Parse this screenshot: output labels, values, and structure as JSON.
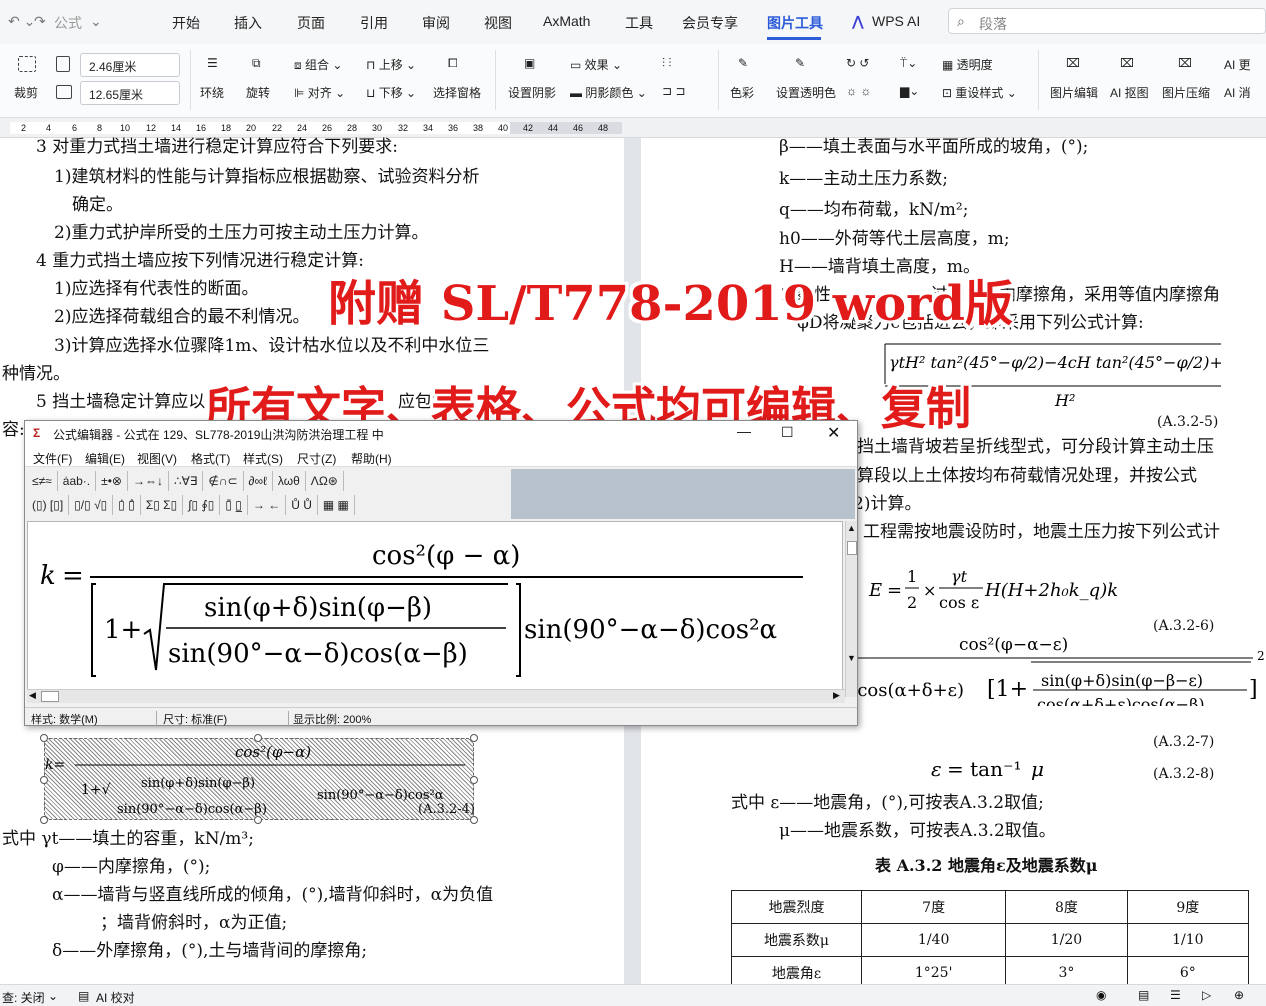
{
  "menubar": {
    "quick_label": "公式",
    "tabs": [
      "开始",
      "插入",
      "页面",
      "引用",
      "审阅",
      "视图",
      "AxMath",
      "工具",
      "会员专享",
      "图片工具",
      "WPS AI"
    ],
    "active_tab": "图片工具",
    "search_placeholder": "段落"
  },
  "ribbon": {
    "crop": "裁剪",
    "width_value": "2.46厘米",
    "height_value": "12.65厘米",
    "wrap": "环绕",
    "rotate": "旋转",
    "group": "组合",
    "align": "对齐",
    "bring_forward": "上移",
    "send_backward": "下移",
    "selection_pane": "选择窗格",
    "shadow": "设置阴影",
    "effect": "效果",
    "shadow_color": "阴影颜色",
    "color": "色彩",
    "transparent_color": "设置透明色",
    "transparency": "透明度",
    "reset_style": "重设样式",
    "picture_edit": "图片编辑",
    "ai_cutout": "AI 抠图",
    "compress": "图片压缩",
    "ai_more": "AI 更",
    "ai_more2": "AI 消"
  },
  "ruler": {
    "ticks": [
      "2",
      "4",
      "6",
      "8",
      "10",
      "12",
      "14",
      "16",
      "18",
      "20",
      "22",
      "24",
      "26",
      "28",
      "30",
      "32",
      "34",
      "36",
      "38",
      "40",
      "42",
      "44",
      "46",
      "48"
    ]
  },
  "left_page": {
    "l1": "3 对重力式挡土墙进行稳定计算应符合下列要求:",
    "l2": "1)建筑材料的性能与计算指标应根据勘察、试验资料分析",
    "l3": "确定。",
    "l4": "2)重力式护岸所受的土压力可按主动土压力计算。",
    "l5": "4 重力式挡土墙应按下列情况进行稳定计算:",
    "l6": "1)应选择有代表性的断面。",
    "l7": "2)应选择荷载组合的最不利情况。",
    "l8": "3)计算应选择水位骤降1m、设计枯水位以及不利中水位三",
    "l9": "种情况。",
    "l10": "5 挡土墙稳定计算应以",
    "l10b": "应包括",
    "l11": "容:",
    "eqno": "(A.3.2-4)",
    "def1": "式中  γt——填土的容重，kN/m³;",
    "def2": "φ——内摩擦角，(°);",
    "def3": "α——墙背与竖直线所成的倾角，(°),墙背仰斜时，α为负值",
    "def4": "；墙背俯斜时，α为正值;",
    "def5": "δ——外摩擦角，(°),土与墙背间的摩擦角;"
  },
  "right_page": {
    "r1": "β——填土表面与水平面所成的坡角，(°);",
    "r2": "k——主动土压力系数;",
    "r3": "q——均布荷载，kN/m²;",
    "r4": "h0——外荷等代土层高度，m;",
    "r5": "H——墙背填土高度，m。",
    "r6a": "2 黏性",
    "r6b": "过加大土内摩擦角，采用等值内摩擦角",
    "r7": "φD将凝聚力c包括进去，即采用下列公式计算:",
    "eq5": "(A.3.2-5)",
    "r8": "挡土墙背坡若呈折线型式，可分段计算主动土压",
    "r9": "算段以上土体按均布荷载情况处理，并按公式",
    "r10": "2)计算。",
    "r11": "工程需按地震设防时，地震土压力按下列公式计",
    "eq6": "(A.3.2-6)",
    "eq7": "(A.3.2-7)",
    "eq8": "(A.3.2-8)",
    "d1": "式中  ε——地震角，(°),可按表A.3.2取值;",
    "d2": "μ——地震系数，可按表A.3.2取值。",
    "table_title": "表 A.3.2  地震角ε及地震系数μ",
    "table_header": [
      "地震烈度",
      "7度",
      "8度",
      "9度"
    ],
    "table_row1": [
      "地震系数μ",
      "1/40",
      "1/20",
      "1/10"
    ],
    "table_row2": [
      "地震角ε",
      "1°25'",
      "3°",
      "6°"
    ]
  },
  "watermark": {
    "line1": "附赠  SL/T778-2019 word版",
    "line2": "所有文字、表格、公式均可编辑、复制"
  },
  "editor": {
    "title": "公式编辑器 - 公式在 129、SL778-2019山洪沟防洪治理工程 中",
    "menu": [
      "文件(F)",
      "编辑(E)",
      "视图(V)",
      "格式(T)",
      "样式(S)",
      "尺寸(Z)",
      "帮助(H)"
    ],
    "sym_row1": [
      "≤≠≈",
      "ẚab·.",
      "±•⊗",
      "→⇔↓",
      "∴∀∃",
      "∉∩⊂",
      "∂∞ℓ",
      "λωθ",
      "ΛΩ⊛"
    ],
    "sym_row2": [
      "(▯) [▯]",
      "▯/▯ √▯",
      "▯̇ ▯̂",
      "Σ▯ Σ▯",
      "∫▯ ∮▯",
      "▯̄ ▯̲",
      "→ ←",
      "Ů Ů",
      "▦ ▦"
    ],
    "status_style": "样式: 数学(M)",
    "status_size": "尺寸: 标准(F)",
    "status_zoom": "显示比例: 200%"
  },
  "statusbar": {
    "left": "查: 关闭",
    "ai": "AI 校对"
  }
}
